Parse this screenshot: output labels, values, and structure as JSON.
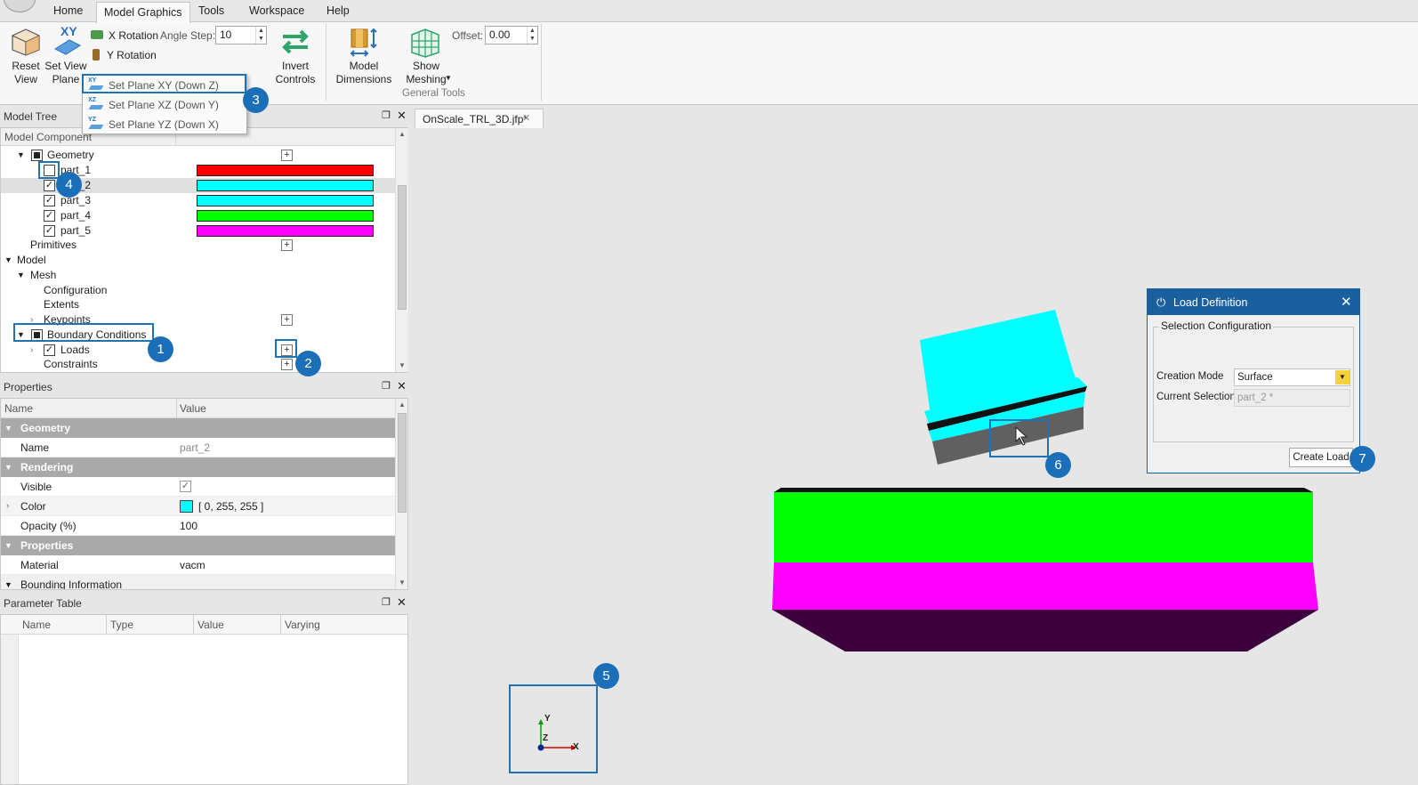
{
  "menubar": {
    "tabs": [
      "Home",
      "Model Graphics",
      "Tools",
      "Workspace",
      "Help"
    ],
    "active_tab": "Model Graphics"
  },
  "ribbon": {
    "reset_view": "Reset\nView",
    "set_view_plane": "Set View\nPlane",
    "xy_label": "XY",
    "x_rotation": "X Rotation",
    "y_rotation": "Y Rotation",
    "angle_step_label": "Angle Step:",
    "angle_step_value": "10",
    "invert_controls": "Invert\nControls",
    "model_dimensions": "Model\nDimensions",
    "show_meshing": "Show\nMeshing",
    "offset_label": "Offset:",
    "offset_value": "0.00",
    "group_general_tools": "General Tools"
  },
  "plane_dropdown": {
    "items": [
      "Set Plane XY (Down Z)",
      "Set Plane XZ (Down Y)",
      "Set Plane YZ (Down X)"
    ],
    "icons": [
      "XY",
      "XZ",
      "YZ"
    ]
  },
  "model_tree": {
    "title": "Model Tree",
    "column": "Model Component",
    "rows": [
      {
        "label": "Geometry"
      },
      {
        "label": "part_1",
        "color": "#ff0000",
        "checked": false
      },
      {
        "label": "part_2",
        "color": "#00ffff",
        "checked": true
      },
      {
        "label": "part_3",
        "color": "#00ffff",
        "checked": true
      },
      {
        "label": "part_4",
        "color": "#00ff00",
        "checked": true
      },
      {
        "label": "part_5",
        "color": "#ff00ff",
        "checked": true
      },
      {
        "label": "Primitives"
      },
      {
        "label": "Model"
      },
      {
        "label": "Mesh"
      },
      {
        "label": "Configuration"
      },
      {
        "label": "Extents"
      },
      {
        "label": "Keypoints"
      },
      {
        "label": "Boundary Conditions"
      },
      {
        "label": "Loads"
      },
      {
        "label": "Constraints"
      }
    ]
  },
  "properties": {
    "title": "Properties",
    "col_name": "Name",
    "col_value": "Value",
    "rows": [
      {
        "section": "Geometry"
      },
      {
        "name": "Name",
        "value": "part_2"
      },
      {
        "section": "Rendering"
      },
      {
        "name": "Visible",
        "value": "✓"
      },
      {
        "name": "Color",
        "value": "[ 0, 255, 255 ]"
      },
      {
        "name": "Opacity (%)",
        "value": "100"
      },
      {
        "section": "Properties"
      },
      {
        "name": "Material",
        "value": "vacm"
      },
      {
        "name": "Bounding Information",
        "value": ""
      }
    ],
    "swatch_color": "#00ffff"
  },
  "parameter_table": {
    "title": "Parameter Table",
    "columns": [
      "Name",
      "Type",
      "Value",
      "Varying"
    ]
  },
  "document_tab": "OnScale_TRL_3D.jfp*",
  "load_dialog": {
    "title": "Load Definition",
    "group": "Selection Configuration",
    "creation_mode_label": "Creation Mode",
    "creation_mode_value": "Surface",
    "current_selection_label": "Current Selection",
    "current_selection_value": "part_2 *",
    "create_button": "Create Load"
  },
  "axes": {
    "y": "Y",
    "z": "Z",
    "x": "X"
  },
  "callouts": [
    "1",
    "2",
    "3",
    "4",
    "5",
    "6",
    "7"
  ],
  "colors": {
    "accent": "#1d72b8",
    "part_red": "#ff0000",
    "part_cyan": "#00ffff",
    "part_green": "#00ff00",
    "part_magenta": "#ff00ff",
    "part_dark": "#3c003c"
  }
}
